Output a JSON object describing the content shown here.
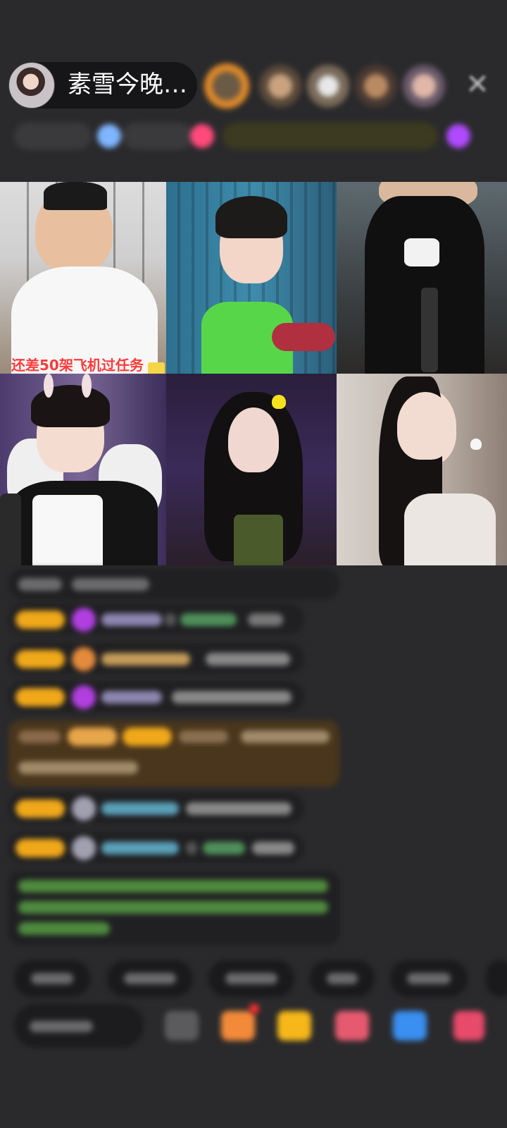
{
  "header": {
    "host_name": "素雪今晚…",
    "close_icon": "close-icon"
  },
  "grid": {
    "tile1_caption": "还差50架飞机过任务"
  },
  "colors": {
    "level_badge": "#f0a81a",
    "chat_bg": "#202022",
    "highlight_bg": "#4a361c"
  }
}
